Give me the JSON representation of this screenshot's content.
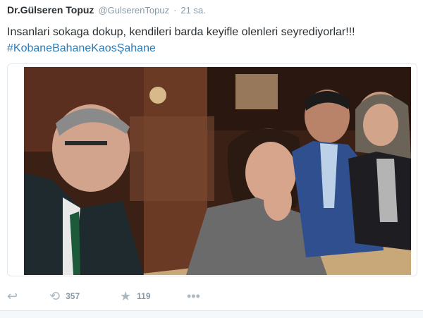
{
  "tweet": {
    "display_name": "Dr.Gülseren Topuz",
    "handle": "@GulserenTopuz",
    "separator": "·",
    "time": "21 sa.",
    "text_line1": "Insanlari sokaga dokup, kendileri barda keyifle olenleri seyrediyorlar!!!",
    "hashtag": "#KobaneBahaneKaosŞahane"
  },
  "actions": {
    "reply_icon": "reply-icon",
    "retweet_icon": "retweet-icon",
    "retweet_count": "357",
    "favorite_icon": "star-icon",
    "favorite_count": "119",
    "more_icon": "more-dots-icon"
  },
  "colors": {
    "link": "#2b7bb9",
    "meta": "#8899a6",
    "text": "#292f33"
  }
}
